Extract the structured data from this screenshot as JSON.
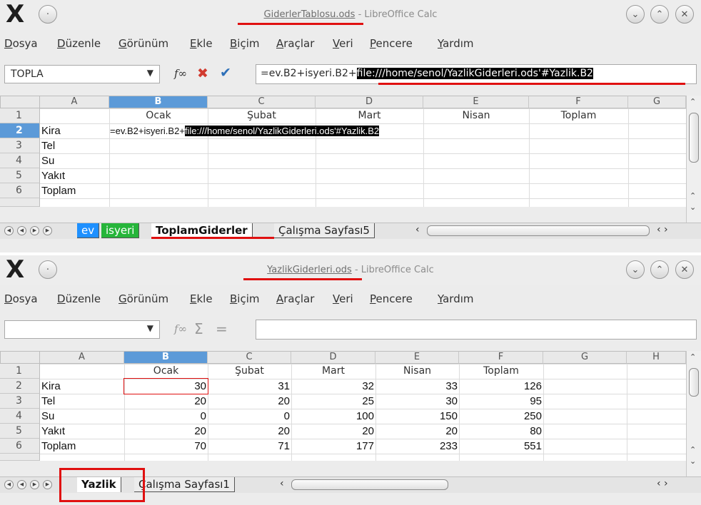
{
  "window1": {
    "title_file": "GiderlerTablosu.ods",
    "title_app": " - LibreOffice Calc",
    "menu": [
      "Dosya",
      "Düzenle",
      "Görünüm",
      "Ekle",
      "Biçim",
      "Araçlar",
      "Veri",
      "Pencere",
      "Yardım"
    ],
    "namebox": "TOPLA",
    "formula_plain": "=ev.B2+isyeri.B2+",
    "formula_highlight": "file:///home/senol/YazlikGiderleri.ods'#Yazlik.B2",
    "columns": [
      "A",
      "B",
      "C",
      "D",
      "E",
      "F",
      "G"
    ],
    "rows": [
      "1",
      "2",
      "3",
      "4",
      "5",
      "6"
    ],
    "header_row": [
      "Ocak",
      "Şubat",
      "Mart",
      "Nisan",
      "Toplam"
    ],
    "labels": [
      "Kira",
      "Tel",
      "Su",
      "Yakıt",
      "Toplam"
    ],
    "cell_b2_plain": "=ev.B2+isyeri.B2+",
    "cell_b2_highlight": "file:///home/senol/YazlikGiderleri.ods'#Yazlik.B2",
    "tabs": [
      "ev",
      "isyeri",
      "ToplamGiderler",
      "Çalışma Sayfası5"
    ]
  },
  "window2": {
    "title_file": "YazlikGiderleri.ods",
    "title_app": " - LibreOffice Calc",
    "menu": [
      "Dosya",
      "Düzenle",
      "Görünüm",
      "Ekle",
      "Biçim",
      "Araçlar",
      "Veri",
      "Pencere",
      "Yardım"
    ],
    "namebox": "",
    "formula": "",
    "columns": [
      "A",
      "B",
      "C",
      "D",
      "E",
      "F",
      "G",
      "H"
    ],
    "rows": [
      "1",
      "2",
      "3",
      "4",
      "5",
      "6"
    ],
    "header_row": [
      "Ocak",
      "Şubat",
      "Mart",
      "Nisan",
      "Toplam"
    ],
    "table": [
      {
        "label": "Kira",
        "values": [
          "30",
          "31",
          "32",
          "33",
          "126"
        ]
      },
      {
        "label": "Tel",
        "values": [
          "20",
          "20",
          "25",
          "30",
          "95"
        ]
      },
      {
        "label": "Su",
        "values": [
          "0",
          "0",
          "100",
          "150",
          "250"
        ]
      },
      {
        "label": "Yakıt",
        "values": [
          "20",
          "20",
          "20",
          "20",
          "80"
        ]
      },
      {
        "label": "Toplam",
        "values": [
          "70",
          "71",
          "177",
          "233",
          "551"
        ]
      }
    ],
    "tabs": [
      "Yazlik",
      "Çalışma Sayfası1"
    ]
  },
  "icons": {
    "minimize": "chevron-down-icon",
    "maximize": "chevron-up-icon",
    "close": "close-icon",
    "accent": "#5c9ad8",
    "annotation": "#e01010"
  }
}
